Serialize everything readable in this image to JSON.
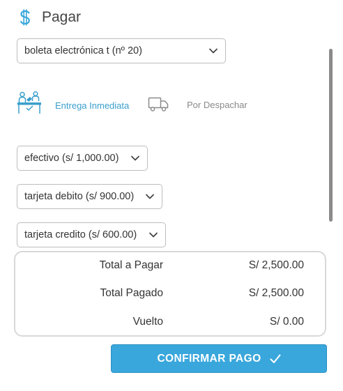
{
  "header": {
    "title": "Pagar",
    "icon": "dollar-icon"
  },
  "document_type": {
    "selected": "boleta electrónica t (nº 20)"
  },
  "delivery": {
    "options": [
      {
        "label": "Entrega Inmediata",
        "icon": "counter-service-icon",
        "active": true
      },
      {
        "label": "Por Despachar",
        "icon": "delivery-truck-icon",
        "active": false
      }
    ]
  },
  "payments": [
    {
      "label": "efectivo (s/ 1,000.00)"
    },
    {
      "label": "tarjeta debito (s/ 900.00)"
    },
    {
      "label": "tarjeta credito (s/ 600.00)"
    }
  ],
  "totals": {
    "total_a_pagar": {
      "label": "Total a Pagar",
      "value": "S/ 2,500.00"
    },
    "total_pagado": {
      "label": "Total Pagado",
      "value": "S/ 2,500.00"
    },
    "vuelto": {
      "label": "Vuelto",
      "value": "S/ 0.00"
    }
  },
  "confirm_button": {
    "label": "CONFIRMAR PAGO"
  },
  "colors": {
    "accent": "#3aa7dc",
    "active_text": "#3a9fcc",
    "inactive_text": "#8a8a8a",
    "border": "#bdbdbd"
  }
}
